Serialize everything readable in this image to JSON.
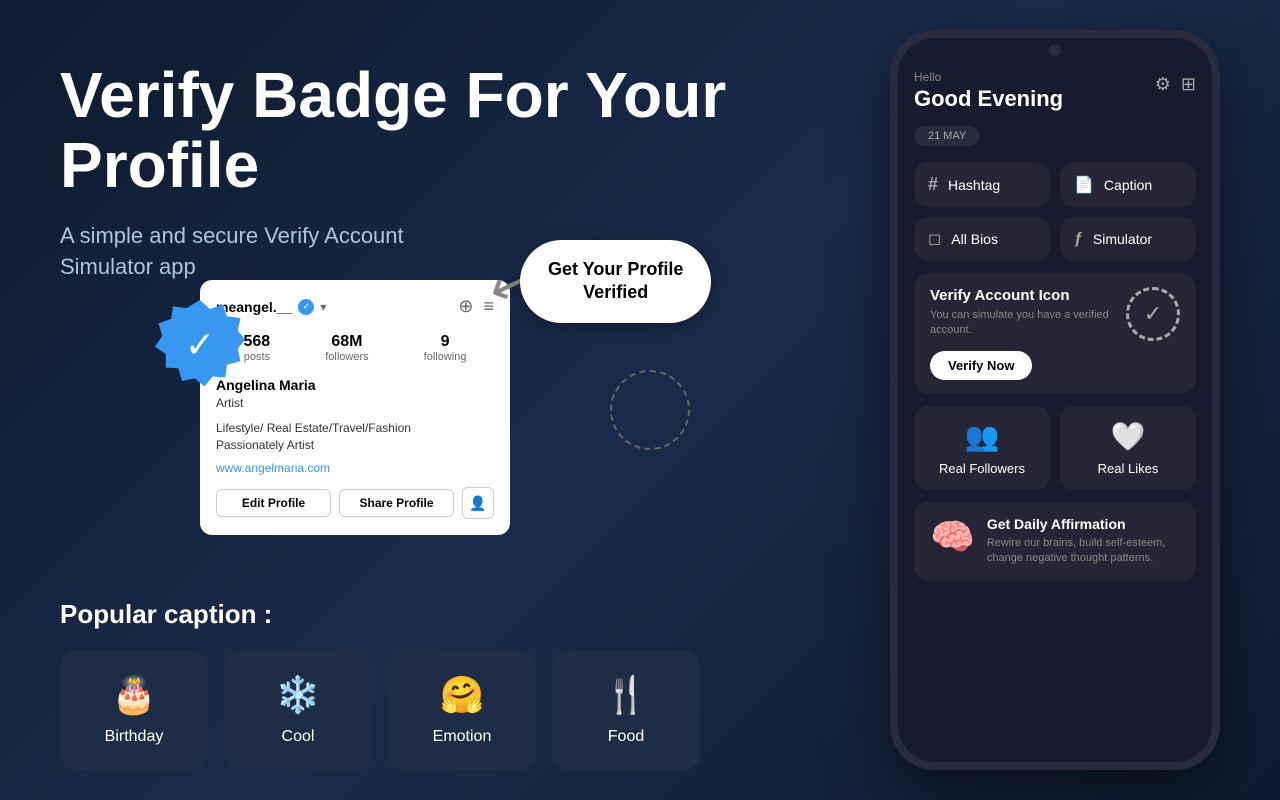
{
  "page": {
    "main_title": "Verify Badge For Your Profile",
    "subtitle": "A simple and secure Verify Account Simulator app"
  },
  "verify_bubble": {
    "text_line1": "Get Your Profile",
    "text_line2": "Verified"
  },
  "profile": {
    "username": "meangel.__",
    "stats": [
      {
        "value": "568",
        "label": "posts"
      },
      {
        "value": "68M",
        "label": "followers"
      },
      {
        "value": "9",
        "label": "following"
      }
    ],
    "name": "Angelina Maria",
    "role": "Artist",
    "bio": "Lifestyle/ Real Estate/Travel/Fashion\nPassionately Artist",
    "website": "www.angelmaria.com",
    "edit_btn": "Edit Profile",
    "share_btn": "Share Profile"
  },
  "popular_caption": {
    "title": "Popular caption :",
    "cards": [
      {
        "id": "birthday",
        "icon": "🎂",
        "label": "Birthday"
      },
      {
        "id": "cool",
        "icon": "❄️",
        "label": "Cool"
      },
      {
        "id": "emotion",
        "icon": "🤗",
        "label": "Emotion"
      },
      {
        "id": "food",
        "icon": "🍴",
        "label": "Food"
      }
    ]
  },
  "phone": {
    "greeting": "Hello",
    "title": "Good Evening",
    "date_badge": "21 MAY",
    "grid_buttons": [
      {
        "icon": "#",
        "label": "Hashtag"
      },
      {
        "icon": "📝",
        "label": "Caption"
      },
      {
        "icon": "◻",
        "label": "All Bios"
      },
      {
        "icon": "ƒ",
        "label": "Simulator"
      }
    ],
    "verify_card": {
      "title": "Verify Account Icon",
      "desc": "You can simulate you have a verified account.",
      "btn_label": "Verify Now"
    },
    "features": [
      {
        "icon": "👥",
        "label": "Real Followers"
      },
      {
        "icon": "🤍",
        "label": "Real Likes"
      }
    ],
    "affirmation": {
      "title": "Get Daily Affirmation",
      "desc": "Rewire our brains, build self-esteem, change negative thought patterns."
    }
  },
  "colors": {
    "background": "#0d1b2e",
    "card_bg": "#1e2d45",
    "phone_bg": "#1a1a2e",
    "accent_blue": "#3897f0",
    "text_muted": "#b0c4de"
  }
}
